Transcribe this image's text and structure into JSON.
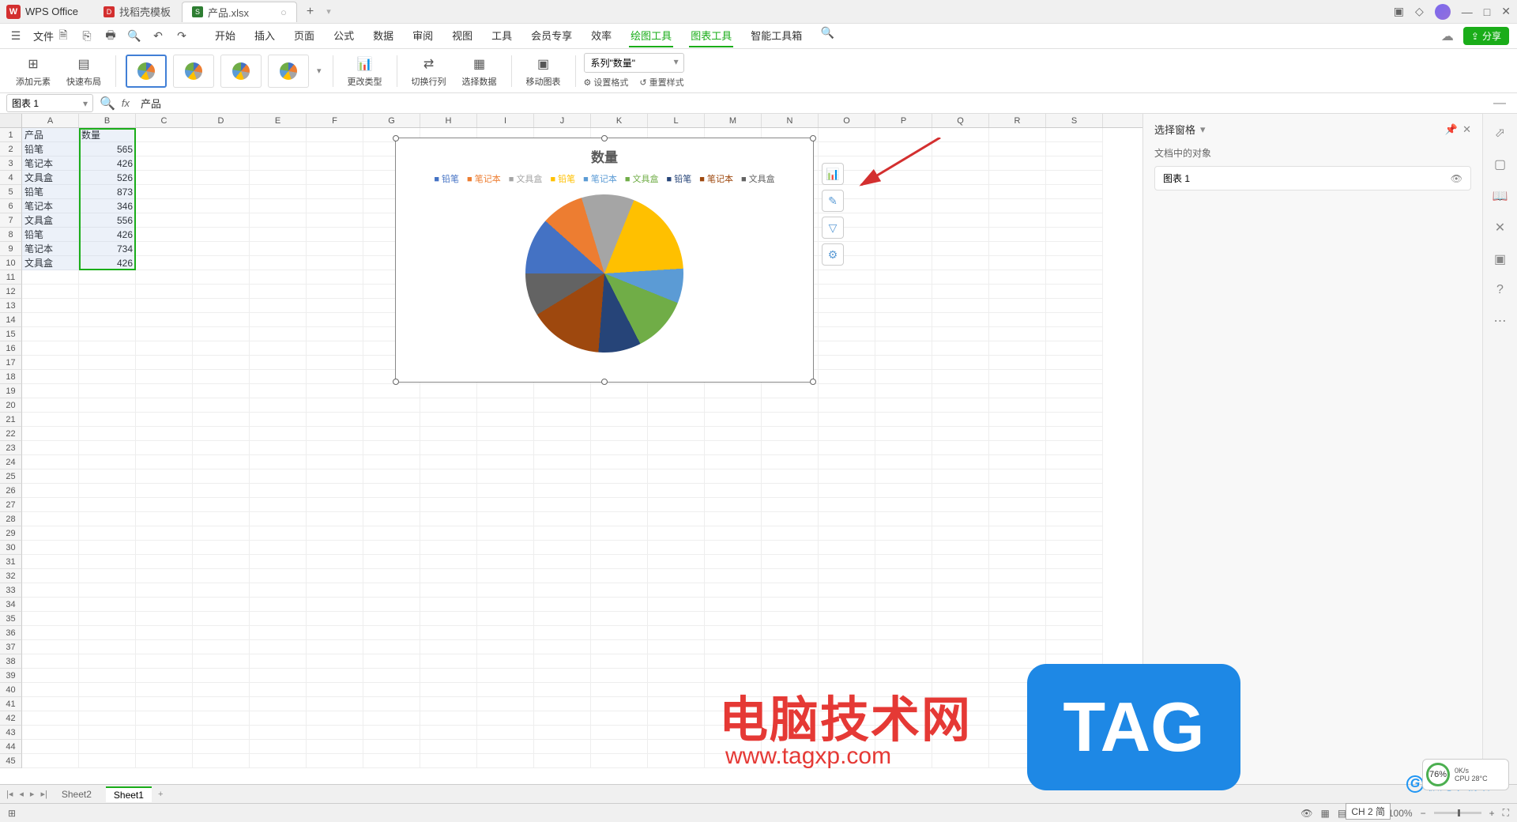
{
  "app": {
    "name": "WPS Office"
  },
  "tabs": [
    {
      "label": "找稻壳模板",
      "icon": "red"
    },
    {
      "label": "产品.xlsx",
      "icon": "green",
      "active": true
    }
  ],
  "menus": {
    "file": "文件",
    "items": [
      "开始",
      "插入",
      "页面",
      "公式",
      "数据",
      "审阅",
      "视图",
      "工具",
      "会员专享",
      "效率"
    ],
    "green": [
      "绘图工具",
      "图表工具",
      "智能工具箱"
    ],
    "active": "图表工具",
    "share": "分享"
  },
  "ribbon": {
    "addElement": "添加元素",
    "quickLayout": "快速布局",
    "changeType": "更改类型",
    "switchRowCol": "切换行列",
    "selectData": "选择数据",
    "moveChart": "移动图表",
    "series": "系列\"数量\"",
    "setFormat": "设置格式",
    "resetStyle": "重置样式"
  },
  "namebox": "图表 1",
  "formula": "产品",
  "columns": [
    "A",
    "B",
    "C",
    "D",
    "E",
    "F",
    "G",
    "H",
    "I",
    "J",
    "K",
    "L",
    "M",
    "N",
    "O",
    "P",
    "Q",
    "R",
    "S"
  ],
  "table": {
    "headers": [
      "产品",
      "数量"
    ],
    "rows": [
      [
        "铅笔",
        565
      ],
      [
        "笔记本",
        426
      ],
      [
        "文具盒",
        526
      ],
      [
        "铅笔",
        873
      ],
      [
        "笔记本",
        346
      ],
      [
        "文具盒",
        556
      ],
      [
        "铅笔",
        426
      ],
      [
        "笔记本",
        734
      ],
      [
        "文具盒",
        426
      ]
    ]
  },
  "chart_data": {
    "type": "pie",
    "title": "数量",
    "categories": [
      "铅笔",
      "笔记本",
      "文具盒",
      "铅笔",
      "笔记本",
      "文具盒",
      "铅笔",
      "笔记本",
      "文具盒"
    ],
    "values": [
      565,
      426,
      526,
      873,
      346,
      556,
      426,
      734,
      426
    ],
    "colors": [
      "#4472c4",
      "#ed7d31",
      "#a5a5a5",
      "#ffc000",
      "#5b9bd5",
      "#70ad47",
      "#264478",
      "#9e480e",
      "#636363"
    ]
  },
  "panel": {
    "title": "选择窗格",
    "subtitle": "文档中的对象",
    "item": "图表 1"
  },
  "sheets": {
    "s1": "Sheet2",
    "s2": "Sheet1"
  },
  "status": {
    "zoom": "100%",
    "ime": "CH 2 简"
  },
  "watermark": {
    "text": "电脑技术网",
    "url": "www.tagxp.com",
    "tag": "TAG",
    "dl": "极光下载站"
  },
  "perf": {
    "pct": "76%",
    "net": "0K/s",
    "cpu": "CPU 28°C"
  }
}
